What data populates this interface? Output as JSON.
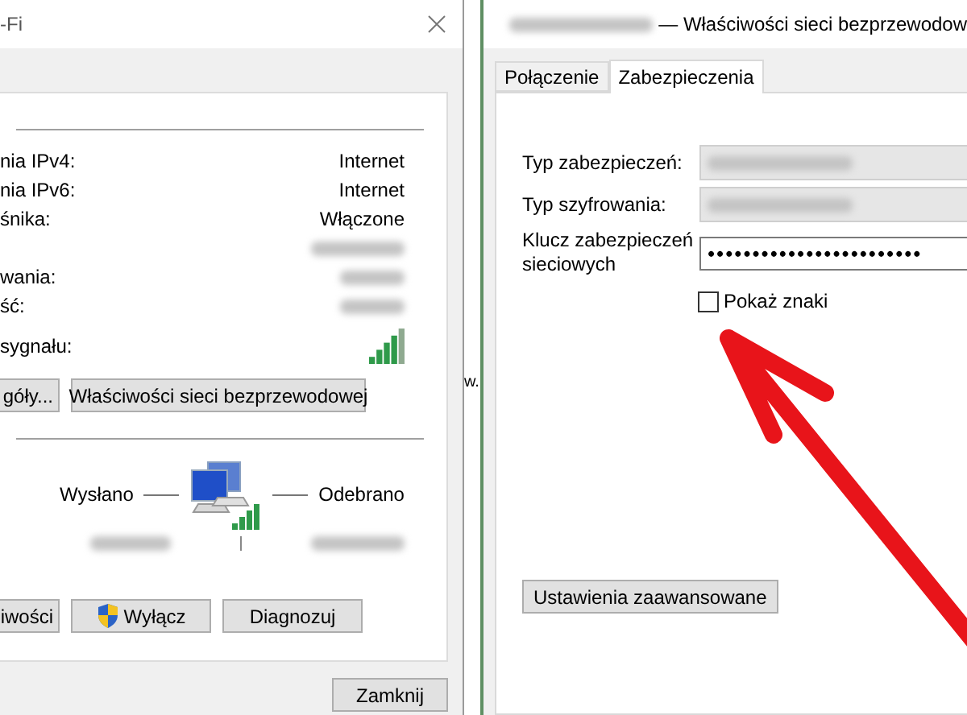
{
  "left_window": {
    "title": "-Fi",
    "details": [
      {
        "kind": "text",
        "label": "nia IPv4:",
        "value": "Internet"
      },
      {
        "kind": "text",
        "label": "nia IPv6:",
        "value": "Internet"
      },
      {
        "kind": "text",
        "label": "śnika:",
        "value": "Włączone"
      },
      {
        "kind": "redacted"
      },
      {
        "kind": "redacted",
        "label": "wania:"
      },
      {
        "kind": "redacted",
        "label": "ść:"
      },
      {
        "kind": "signal",
        "label": "sygnału:"
      }
    ],
    "buttons_top": [
      "góły...",
      "Właściwości sieci bezprzewodowej"
    ],
    "activity": {
      "sent_label": "Wysłano",
      "received_label": "Odebrano"
    },
    "buttons_bottom": [
      {
        "kind": "plain",
        "label": "iwości"
      },
      {
        "kind": "shield",
        "label": "Wyłącz"
      },
      {
        "kind": "plain",
        "label": "Diagnozuj"
      }
    ],
    "close_button": "Zamknij"
  },
  "behind_text": "w.",
  "right_window": {
    "title": "— Właściwości sieci bezprzewodow",
    "tabs": [
      {
        "label": "Połączenie",
        "selected": false
      },
      {
        "label": "Zabezpieczenia",
        "selected": true
      }
    ],
    "fields": [
      {
        "kind": "redacted",
        "label": "Typ zabezpieczeń:"
      },
      {
        "kind": "redacted",
        "label": "Typ szyfrowania:"
      },
      {
        "kind": "password",
        "label": "Klucz zabezpieczeń sieciowych",
        "value": "••••••••••••••••••••••••"
      }
    ],
    "show_chars": {
      "label": "Pokaż znaki",
      "checked": false
    },
    "advanced_button": "Ustawienia zaawansowane"
  }
}
